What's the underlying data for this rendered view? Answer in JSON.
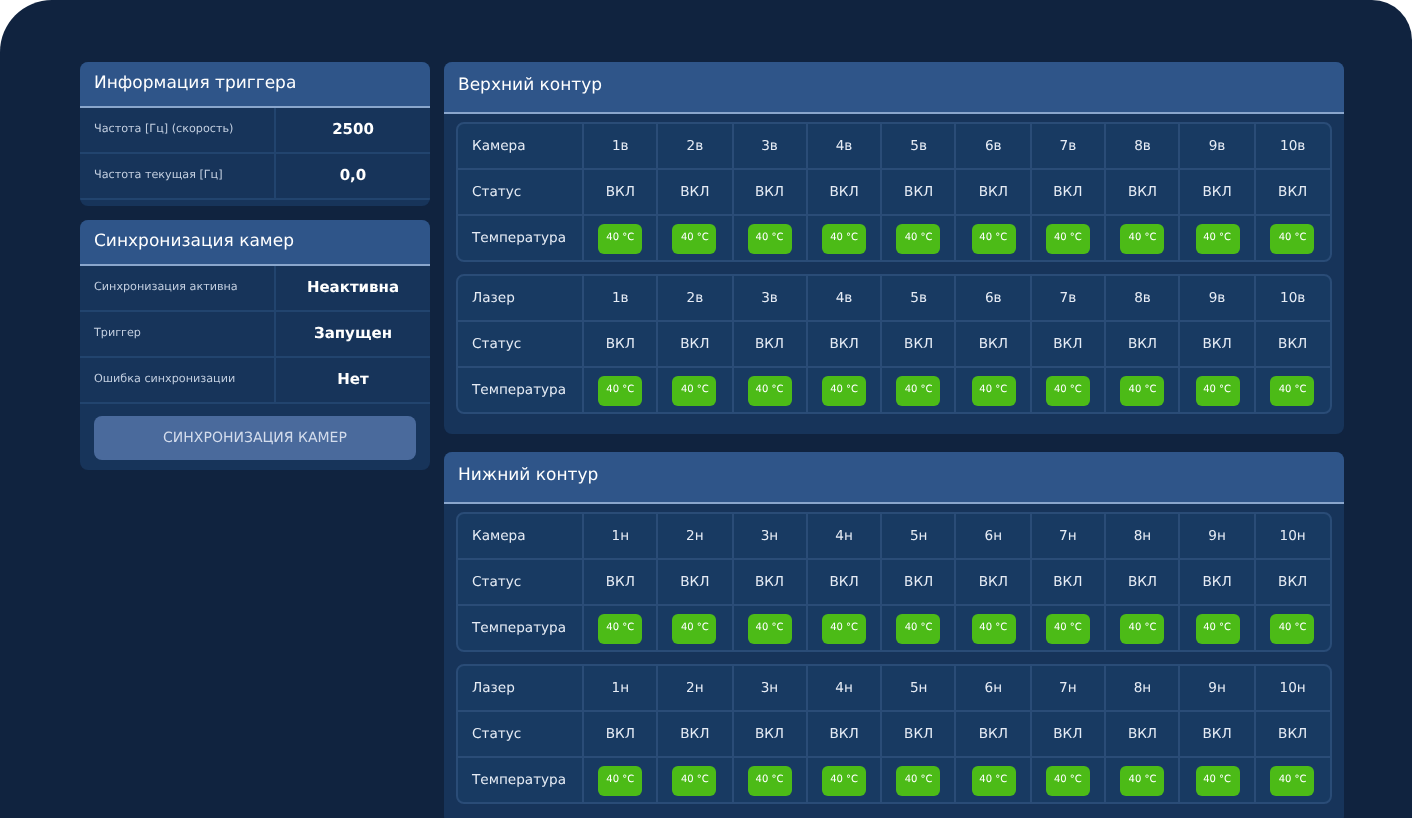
{
  "trigger_info": {
    "title": "Информация триггера",
    "rows": [
      {
        "label": "Частота [Гц] (скорость)",
        "value": "2500"
      },
      {
        "label": "Частота текущая [Гц]",
        "value": "0,0"
      }
    ]
  },
  "camera_sync": {
    "title": "Синхронизация камер",
    "rows": [
      {
        "label": "Синхронизация активна",
        "value": "Неактивна"
      },
      {
        "label": "Триггер",
        "value": "Запущен"
      },
      {
        "label": "Ошибка синхронизации",
        "value": "Нет"
      }
    ],
    "button": "СИНХРОНИЗАЦИЯ КАМЕР"
  },
  "contours": [
    {
      "title": "Верхний контур",
      "tables": [
        {
          "header_label": "Камера",
          "columns": [
            "1в",
            "2в",
            "3в",
            "4в",
            "5в",
            "6в",
            "7в",
            "8в",
            "9в",
            "10в"
          ],
          "status_label": "Статус",
          "statuses": [
            "ВКЛ",
            "ВКЛ",
            "ВКЛ",
            "ВКЛ",
            "ВКЛ",
            "ВКЛ",
            "ВКЛ",
            "ВКЛ",
            "ВКЛ",
            "ВКЛ"
          ],
          "temp_label": "Температура",
          "temps": [
            "40 °C",
            "40 °C",
            "40 °C",
            "40 °C",
            "40 °C",
            "40 °C",
            "40 °C",
            "40 °C",
            "40 °C",
            "40 °C"
          ]
        },
        {
          "header_label": "Лазер",
          "columns": [
            "1в",
            "2в",
            "3в",
            "4в",
            "5в",
            "6в",
            "7в",
            "8в",
            "9в",
            "10в"
          ],
          "status_label": "Статус",
          "statuses": [
            "ВКЛ",
            "ВКЛ",
            "ВКЛ",
            "ВКЛ",
            "ВКЛ",
            "ВКЛ",
            "ВКЛ",
            "ВКЛ",
            "ВКЛ",
            "ВКЛ"
          ],
          "temp_label": "Температура",
          "temps": [
            "40 °C",
            "40 °C",
            "40 °C",
            "40 °C",
            "40 °C",
            "40 °C",
            "40 °C",
            "40 °C",
            "40 °C",
            "40 °C"
          ]
        }
      ]
    },
    {
      "title": "Нижний контур",
      "tables": [
        {
          "header_label": "Камера",
          "columns": [
            "1н",
            "2н",
            "3н",
            "4н",
            "5н",
            "6н",
            "7н",
            "8н",
            "9н",
            "10н"
          ],
          "status_label": "Статус",
          "statuses": [
            "ВКЛ",
            "ВКЛ",
            "ВКЛ",
            "ВКЛ",
            "ВКЛ",
            "ВКЛ",
            "ВКЛ",
            "ВКЛ",
            "ВКЛ",
            "ВКЛ"
          ],
          "temp_label": "Температура",
          "temps": [
            "40 °C",
            "40 °C",
            "40 °C",
            "40 °C",
            "40 °C",
            "40 °C",
            "40 °C",
            "40 °C",
            "40 °C",
            "40 °C"
          ]
        },
        {
          "header_label": "Лазер",
          "columns": [
            "1н",
            "2н",
            "3н",
            "4н",
            "5н",
            "6н",
            "7н",
            "8н",
            "9н",
            "10н"
          ],
          "status_label": "Статус",
          "statuses": [
            "ВКЛ",
            "ВКЛ",
            "ВКЛ",
            "ВКЛ",
            "ВКЛ",
            "ВКЛ",
            "ВКЛ",
            "ВКЛ",
            "ВКЛ",
            "ВКЛ"
          ],
          "temp_label": "Температура",
          "temps": [
            "40 °C",
            "40 °C",
            "40 °C",
            "40 °C",
            "40 °C",
            "40 °C",
            "40 °C",
            "40 °C",
            "40 °C",
            "40 °C"
          ]
        }
      ]
    }
  ]
}
